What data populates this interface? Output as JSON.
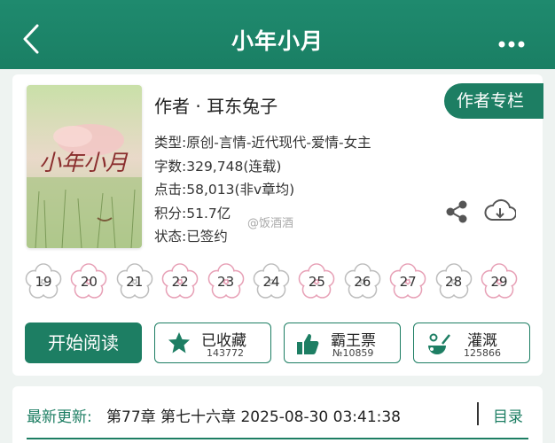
{
  "header": {
    "title": "小年小月",
    "back_icon": "chevron-left-icon",
    "more_icon": "more-dots-icon"
  },
  "book": {
    "cover_title": "小年小月",
    "author_line": "作者 · 耳东兔子",
    "author_column_label": "作者专栏",
    "info": {
      "type": "类型:原创-言情-近代现代-爱情-女主",
      "words": "字数:329,748(连载)",
      "clicks": "点击:58,013(非v章均)",
      "points": "积分:51.7亿",
      "status": "状态:已签约"
    },
    "watermark": "@饭酒酒"
  },
  "calendar": {
    "days": [
      {
        "day": "19",
        "style": "gray"
      },
      {
        "day": "20",
        "style": "pink"
      },
      {
        "day": "21",
        "style": "gray"
      },
      {
        "day": "22",
        "style": "pink"
      },
      {
        "day": "23",
        "style": "pink"
      },
      {
        "day": "24",
        "style": "gray"
      },
      {
        "day": "25",
        "style": "pink"
      },
      {
        "day": "26",
        "style": "gray"
      },
      {
        "day": "27",
        "style": "pink"
      },
      {
        "day": "28",
        "style": "gray"
      },
      {
        "day": "29",
        "style": "pink"
      }
    ]
  },
  "actions": {
    "start_reading": "开始阅读",
    "favorite": {
      "label": "已收藏",
      "count": "143772",
      "icon": "star-icon"
    },
    "bawangpiao": {
      "label": "霸王票",
      "count": "№10859",
      "icon": "thumbs-up-icon"
    },
    "irrigate": {
      "label": "灌溉",
      "count": "125866",
      "icon": "watering-icon"
    }
  },
  "update": {
    "label": "最新更新:",
    "text": "第77章 第七十六章 2025-08-30 03:41:38",
    "toc": "目录"
  },
  "colors": {
    "brand": "#1d7e63",
    "pink": "#e7a0b6",
    "gray": "#bdbdbd"
  }
}
